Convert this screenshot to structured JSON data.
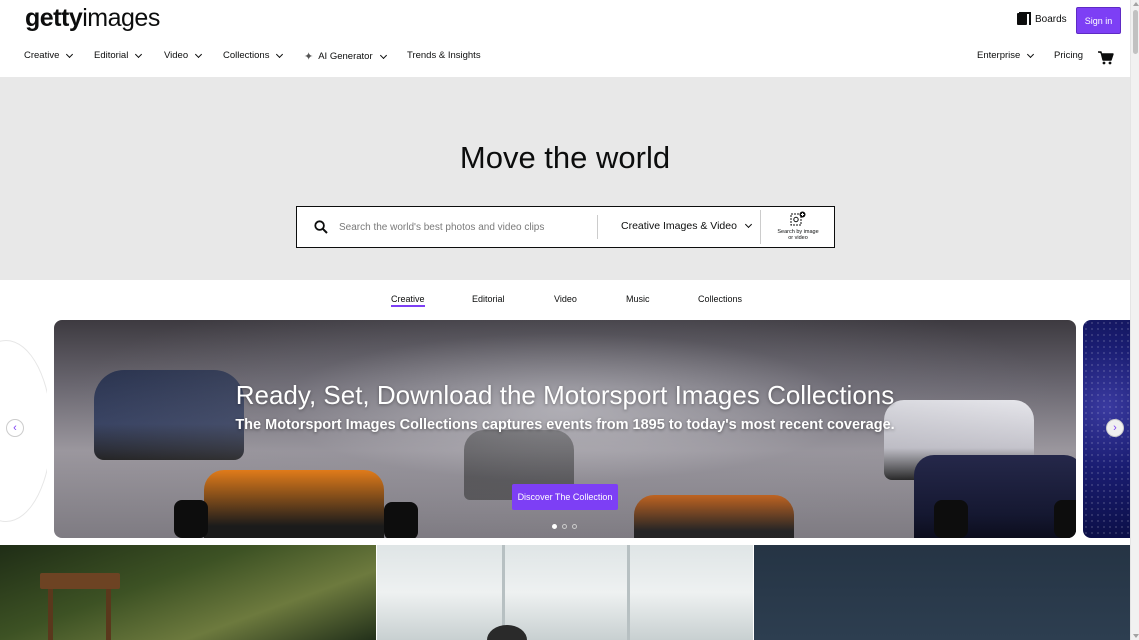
{
  "header": {
    "logo_bold": "getty",
    "logo_light": "images",
    "boards_label": "Boards",
    "signin_label": "Sign in"
  },
  "nav": {
    "creative": "Creative",
    "editorial": "Editorial",
    "video": "Video",
    "collections": "Collections",
    "ai_generator": "AI Generator",
    "trends": "Trends & Insights",
    "enterprise": "Enterprise",
    "pricing": "Pricing"
  },
  "hero": {
    "title": "Move the world",
    "search_placeholder": "Search the world's best photos and video clips",
    "search_type": "Creative Images & Video",
    "image_search_line1": "Search by image",
    "image_search_line2": "or video"
  },
  "tabs": {
    "creative": "Creative",
    "editorial": "Editorial",
    "video": "Video",
    "music": "Music",
    "collections": "Collections"
  },
  "carousel": {
    "title": "Ready, Set, Download the Motorsport Images Collections",
    "subtitle": "The Motorsport Images Collections captures events from 1895 to today's most recent coverage.",
    "cta": "Discover The Collection",
    "prev": "‹",
    "next": "›"
  },
  "colors": {
    "accent": "#7d3ff5",
    "hero_bg": "#e8e8e8",
    "text": "#0c0d0d"
  },
  "icons": [
    "boards-icon",
    "cart-icon",
    "sparkle-icon",
    "search-icon",
    "image-search-icon",
    "chevron-down-icon",
    "chevron-left-icon",
    "chevron-right-icon"
  ]
}
